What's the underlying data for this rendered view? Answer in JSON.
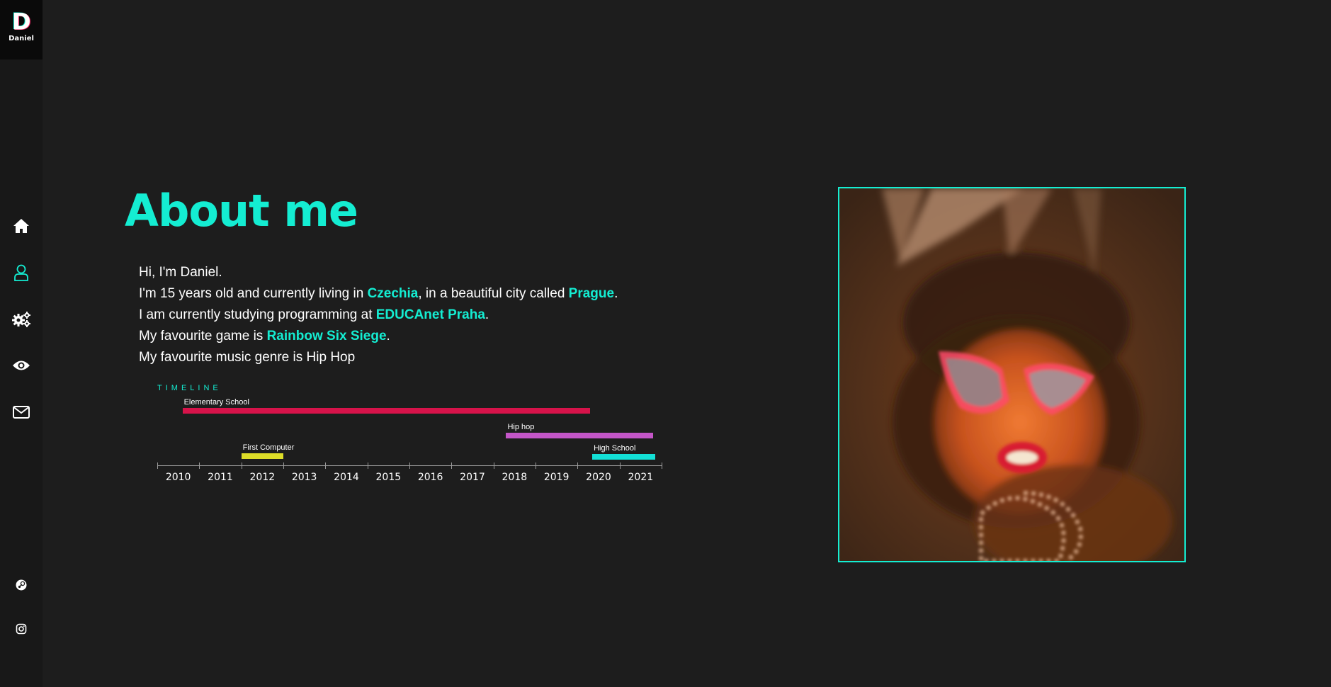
{
  "sidebar": {
    "logo_letter": "D",
    "logo_name": "Daniel",
    "nav": [
      {
        "name": "home-icon",
        "active": false
      },
      {
        "name": "user-icon",
        "active": true
      },
      {
        "name": "gears-icon",
        "active": false
      },
      {
        "name": "eye-icon",
        "active": false
      },
      {
        "name": "envelope-icon",
        "active": false
      }
    ],
    "social": [
      {
        "name": "steam-icon"
      },
      {
        "name": "instagram-icon"
      }
    ]
  },
  "main": {
    "title": "About me",
    "bio": {
      "line1": "Hi, I'm Daniel.",
      "line2_pre": "I'm 15 years old and currently living in ",
      "line2_hl1": "Czechia",
      "line2_mid": ", in a beautiful city called ",
      "line2_hl2": "Prague",
      "line2_post": ".",
      "line3_pre": "I am currently studying programming at ",
      "line3_hl": "EDUCAnet Praha",
      "line3_post": ".",
      "line4_pre": "My favourite game is ",
      "line4_hl": "Rainbow Six Siege",
      "line4_post": ".",
      "line5": "My favourite music genre is Hip Hop"
    }
  },
  "timeline": {
    "label": "TIMELINE",
    "years": [
      "2010",
      "2011",
      "2012",
      "2013",
      "2014",
      "2015",
      "2016",
      "2017",
      "2018",
      "2019",
      "2020",
      "2021"
    ],
    "events": [
      {
        "label": "Elementary School",
        "start": 2010.6,
        "end": 2020.3,
        "color": "#d6134a",
        "row": 0
      },
      {
        "label": "Hip hop",
        "start": 2018.3,
        "end": 2021.8,
        "color": "#c456c8",
        "row": 1
      },
      {
        "label": "First Computer",
        "start": 2012.0,
        "end": 2013.0,
        "color": "#dddd28",
        "row": 2
      },
      {
        "label": "High School",
        "start": 2020.35,
        "end": 2021.85,
        "color": "#13e0d6",
        "row": 3
      }
    ]
  },
  "colors": {
    "accent": "#14edd2",
    "background": "#1d1d1d",
    "sidebar": "#181818"
  }
}
